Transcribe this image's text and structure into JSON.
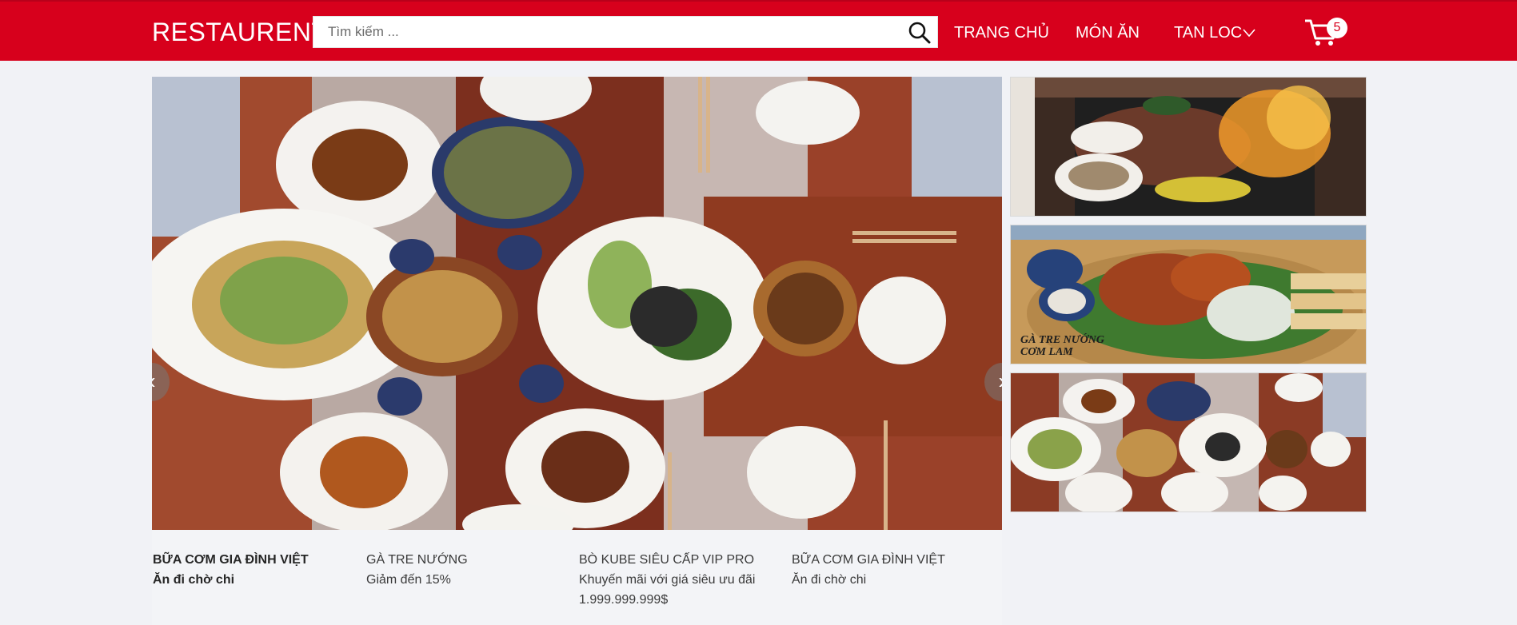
{
  "header": {
    "brand": "RESTAURENT",
    "search_placeholder": "Tìm kiếm ...",
    "nav": [
      {
        "label": "TRANG CHỦ"
      },
      {
        "label": "MÓN ĂN"
      },
      {
        "label": "TAN LOC"
      }
    ],
    "cart_count": "5",
    "colors": {
      "bar": "#d7001c",
      "text": "#ffffff"
    },
    "icons": [
      "search-icon",
      "chevron-down-icon",
      "cart-icon"
    ]
  },
  "banner": {
    "side_overlay_text": [
      "GÀ TRE NƯỚNG",
      "CƠM LAM"
    ],
    "arrow_left": "‹",
    "arrow_right": "›"
  },
  "captions": [
    {
      "title": "BỮA CƠM GIA ĐÌNH VIỆT",
      "subtitle": "Ăn đi chờ chi",
      "active": true
    },
    {
      "title": "GÀ TRE NƯỚNG",
      "subtitle": "Giảm đến 15%"
    },
    {
      "title": "BÒ KUBE SIÊU CẤP VIP PRO",
      "subtitle": "Khuyến mãi với giá siêu ưu đãi 1.999.999.999$"
    },
    {
      "title": "BỮA CƠM GIA ĐÌNH VIỆT",
      "subtitle": "Ăn đi chờ chi"
    }
  ]
}
